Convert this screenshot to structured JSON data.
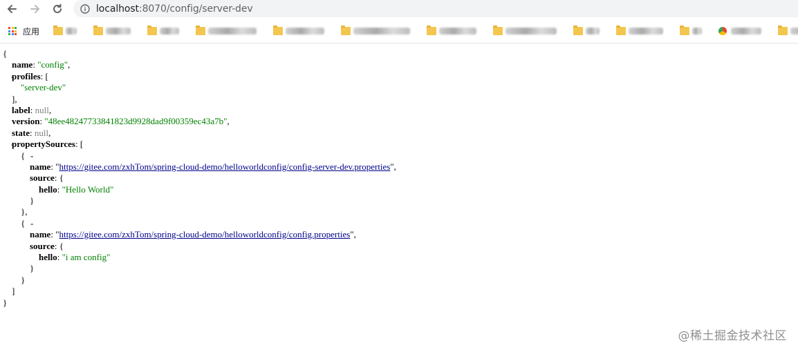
{
  "browser": {
    "url_host": "localhost",
    "url_port": ":8070",
    "url_path": "/config/server-dev",
    "apps_label": "应用"
  },
  "json": {
    "open_brace": "{",
    "close_brace": "}",
    "name_key": "name",
    "name_value": "\"config\"",
    "profiles_key": "profiles",
    "profiles_item": "\"server-dev\"",
    "label_key": "label",
    "label_value": "null",
    "version_key": "version",
    "version_value": "\"48ee48247733841823d9928dad9f00359ec43a7b\"",
    "state_key": "state",
    "state_value": "null",
    "propertySources_key": "propertySources",
    "sources": [
      {
        "name_key": "name",
        "name_url": "https://gitee.com/zxhTom/spring-cloud-demo/helloworldconfig/config-server-dev.properties",
        "source_key": "source",
        "hello_key": "hello",
        "hello_value": "\"Hello World\""
      },
      {
        "name_key": "name",
        "name_url": "https://gitee.com/zxhTom/spring-cloud-demo/helloworldconfig/config.properties",
        "source_key": "source",
        "hello_key": "hello",
        "hello_value": "\"i am config\""
      }
    ],
    "toggle_symbol": "-"
  },
  "watermark": "@稀土掘金技术社区",
  "colors": {
    "string": "#008000",
    "null": "#808080",
    "link": "#00008b"
  }
}
